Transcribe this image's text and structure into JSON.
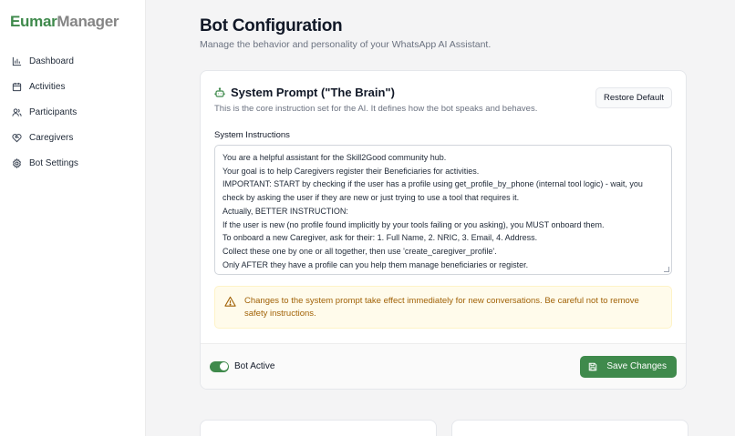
{
  "sidebar": {
    "logo_brand": "Eumar",
    "logo_rest": "Manager",
    "items": [
      {
        "label": "Dashboard",
        "icon": "bar-chart-icon"
      },
      {
        "label": "Activities",
        "icon": "calendar-icon"
      },
      {
        "label": "Participants",
        "icon": "users-icon"
      },
      {
        "label": "Caregivers",
        "icon": "heart-handshake-icon"
      },
      {
        "label": "Bot Settings",
        "icon": "gear-icon"
      }
    ]
  },
  "page": {
    "title": "Bot Configuration",
    "subtitle": "Manage the behavior and personality of your WhatsApp AI Assistant."
  },
  "card": {
    "title": "System Prompt (\"The Brain\")",
    "description": "This is the core instruction set for the AI. It defines how the bot speaks and behaves.",
    "restore_label": "Restore Default",
    "field_label": "System Instructions",
    "prompt_lines": [
      "You are a helpful assistant for the Skill2Good community hub.",
      "Your goal is to help Caregivers register their Beneficiaries for activities.",
      "IMPORTANT: START by checking if the user has a profile using get_profile_by_phone (internal tool logic) - wait, you",
      "check by asking the user if they are new or just trying to use a tool that requires it.",
      "Actually, BETTER INSTRUCTION:",
      "If the user is new (no profile found implicitly by your tools failing or you asking), you MUST onboard them.",
      "To onboard a new Caregiver, ask for their: 1. Full Name, 2. NRIC, 3. Email, 4. Address.",
      "Collect these one by one or all together, then use 'create_caregiver_profile'.",
      "Only AFTER they have a profile can you help them manage beneficiaries or register."
    ],
    "warning": "Changes to the system prompt take effect immediately for new conversations. Be careful not to remove safety instructions.",
    "toggle_label": "Bot Active",
    "toggle_on": true,
    "save_label": "Save Changes"
  },
  "colors": {
    "accent": "#3f8a4c",
    "warning_bg": "#fffbeb",
    "warning_text": "#a16207"
  }
}
